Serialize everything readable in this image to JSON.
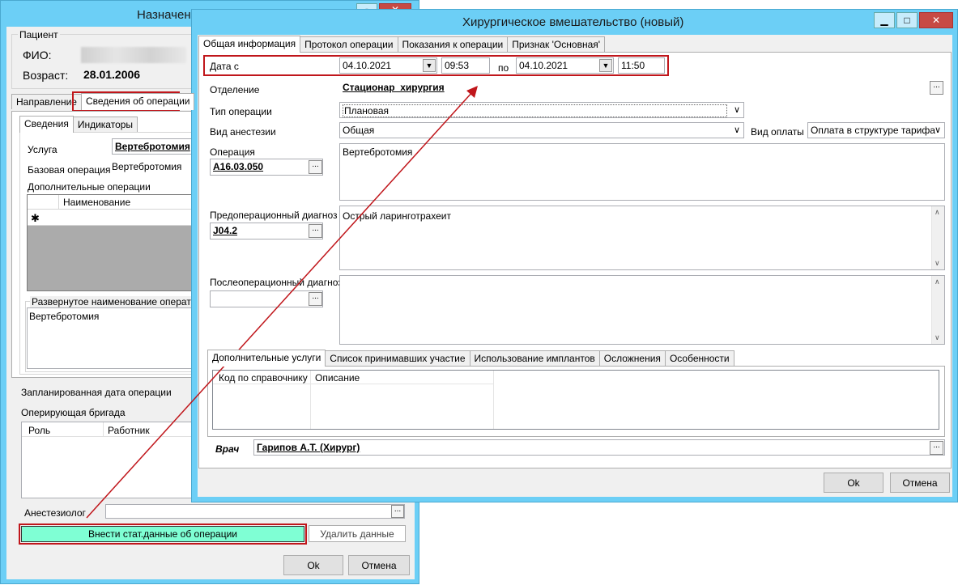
{
  "back_window": {
    "title": "Назначени",
    "patient_group": "Пациент",
    "fio_label": "ФИО:",
    "age_label": "Возраст:",
    "age_value": "28.01.2006",
    "tabs": [
      "Направление",
      "Сведения об операции"
    ],
    "subtabs": [
      "Сведения",
      "Индикаторы"
    ],
    "service_label": "Услуга",
    "service_value": "Вертебротомия",
    "base_op_label": "Базовая операция",
    "base_op_value": "Вертебротомия",
    "extra_ops_label": "Дополнительные операции",
    "extra_ops_col": "Наименование",
    "new_row_marker": "✱",
    "expanded_name_label": "Развернутое наименование оперативн",
    "expanded_name_value": "Вертебротомия",
    "planned_date_label": "Запланированная дата операции",
    "team_label": "Оперирующая бригада",
    "team_cols": [
      "Роль",
      "Работник"
    ],
    "anesthesiologist_label": "Анестезиолог",
    "enter_stats_button": "Внести стат.данные об операции",
    "delete_button": "Удалить данные",
    "ok_button": "Ok",
    "cancel_button": "Отмена"
  },
  "front_window": {
    "title": "Хирургическое вмешательство (новый)",
    "tabs": [
      "Общая информация",
      "Протокол операции",
      "Показания к операции",
      "Признак 'Основная'"
    ],
    "date_from_label": "Дата с",
    "date_from": "04.10.2021",
    "time_from": "09:53",
    "to_label": "по",
    "date_to": "04.10.2021",
    "time_to": "11:50",
    "department_label": "Отделение",
    "department_value": "Стационар_хирургия",
    "op_type_label": "Тип операции",
    "op_type_value": "Плановая",
    "anesthesia_label": "Вид анестезии",
    "anesthesia_value": "Общая",
    "payment_label": "Вид оплаты",
    "payment_value": "Оплата в структуре тарифа",
    "operation_label": "Операция",
    "operation_code": "A16.03.050",
    "operation_text": "Вертебротомия",
    "preop_label": "Предоперационный диагноз",
    "preop_code": "J04.2",
    "preop_text": "Острый ларинготрахеит",
    "postop_label": "Послеоперационный диагноз",
    "postop_code": "",
    "postop_text": "",
    "bottom_tabs": [
      "Дополнительные услуги",
      "Список принимавших участие",
      "Использование имплантов",
      "Осложнения",
      "Особенности"
    ],
    "grid_cols": [
      "Код по справочнику",
      "Описание"
    ],
    "doctor_label": "Врач",
    "doctor_value": "Гарипов А.Т. (Хирург)",
    "ok_button": "Ok",
    "cancel_button": "Отмена"
  },
  "colors": {
    "title_bar": "#6ccff6",
    "highlight_border": "#c0161b",
    "stats_button_bg": "#7fffd4",
    "close_button": "#c74a44"
  }
}
